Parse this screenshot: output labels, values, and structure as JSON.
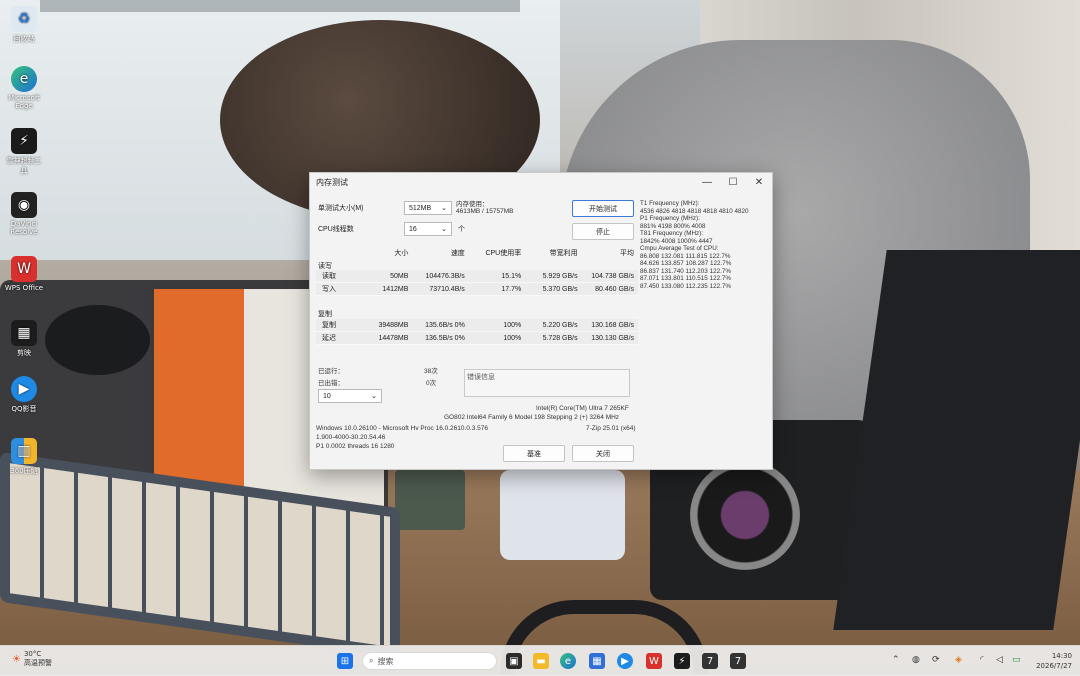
{
  "desktop": {
    "icons": [
      {
        "label": "回收站"
      },
      {
        "label": "Microsoft Edge"
      },
      {
        "label": "雷神超频工具"
      },
      {
        "label": "DaVinci Resolve"
      },
      {
        "label": "WPS Office"
      },
      {
        "label": "剪映"
      },
      {
        "label": "QQ影音"
      },
      {
        "label": "360压缩"
      }
    ]
  },
  "dialog": {
    "title": "内存测试",
    "size_label": "单测试大小(M)",
    "size_value": "512MB",
    "threads_label": "CPU线程数",
    "threads_value": "16",
    "threads_suffix": "个",
    "mem_used_label": "内存使用：",
    "mem_used_value": "4613MB / 15757MB",
    "start_button": "开始测试",
    "stop_button": "停止",
    "columns": [
      "大小",
      "速度",
      "CPU使用率",
      "带宽利用",
      "平均"
    ],
    "group1_label": "读写",
    "group1_rows": [
      {
        "name": "读取",
        "c1": "50MB",
        "c2": "104476.3B/s",
        "c3": "15.1%",
        "c4": "5.929 GB/s",
        "c5": "104.738 GB/s"
      },
      {
        "name": "写入",
        "c1": "1412MB",
        "c2": "73710.4B/s",
        "c3": "17.7%",
        "c4": "5.370 GB/s",
        "c5": "80.460 GB/s"
      }
    ],
    "group2_label": "复制",
    "group2_rows": [
      {
        "name": "复制",
        "c1": "39488MB",
        "c2": "135.6B/s 0%",
        "c3": "100%",
        "c4": "5.220 GB/s",
        "c5": "130.168 GB/s"
      },
      {
        "name": "延迟",
        "c1": "14478MB",
        "c2": "136.5B/s 0%",
        "c3": "100%",
        "c4": "5.728 GB/s",
        "c5": "130.130 GB/s"
      }
    ],
    "passes_label": "已运行：",
    "passes_value": "38次",
    "errors_label": "已出错：",
    "errors_value": "0次",
    "loop_value": "10",
    "log_label": "错误信息",
    "right_log": [
      "T1 Frequency (MHz):",
      "  4536 4826 4818 4818 4818 4810 4820",
      "P1 Frequency (MHz):",
      "  881% 4198 800% 4008",
      "T81 Frequency (MHz):",
      "  1842% 4008 1000% 4447",
      "Cmpu Average Test of CPU:",
      "  86.808 132.081 111.815 122.7%",
      "  84.626 133.857 108.287 122.7%",
      "  86.837 131.740 112.203 122.7%",
      "  87.071 133.801 110.515 122.7%",
      "  87.450 133.080 112.235 122.7%"
    ],
    "cpu_info": "Intel(R) Core(TM) Ultra 7 265KF",
    "cpu_info2": "GO802 Intel64 Family 6 Model 198 Stepping 2 (+) 3264 MHz",
    "os_info": "Windows 10.0.26100 - Microsoft Hv Proc 16.0.2610.0.3.576",
    "ver_info": "7-Zip 25.01 (x64)",
    "cache_info": "1.900-4000-30.20.54.46",
    "threads_info": "P1 0.0002 threads 16 1280",
    "bench_button": "基准",
    "close_button": "关闭"
  },
  "taskbar": {
    "weather_temp": "30°C",
    "weather_desc": "高温预警",
    "search_placeholder": "搜索",
    "time": "14:30",
    "date": "2026/7/27"
  }
}
